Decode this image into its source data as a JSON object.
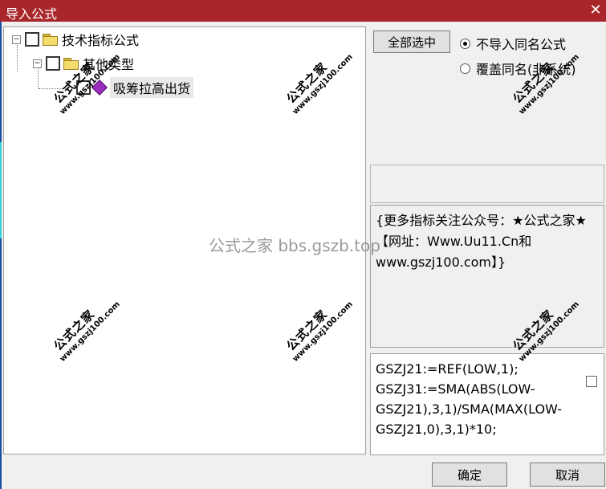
{
  "window": {
    "title": "导入公式",
    "close_glyph": "✕"
  },
  "tree": {
    "items": [
      {
        "label": "技术指标公式",
        "expander": "−",
        "icon": "folder-icon"
      },
      {
        "label": "其他类型",
        "expander": "−",
        "icon": "folder-icon"
      },
      {
        "label": "吸筹拉高出货",
        "icon": "formula-gem-icon"
      }
    ]
  },
  "options": {
    "select_all_label": "全部选中",
    "radio_skip_label": "不导入同名公式",
    "radio_overwrite_label": "覆盖同名(非系统)",
    "selected_radio": "skip"
  },
  "description": "{更多指标关注公众号：★公式之家★【网址：Www.Uu11.Cn和www.gszj100.com】}",
  "formula": "GSZJ21:=REF(LOW,1);\nGSZJ31:=SMA(ABS(LOW-GSZJ21),3,1)/SMA(MAX(LOW-GSZJ21,0),3,1)*10;",
  "buttons": {
    "ok": "确定",
    "cancel": "取消"
  },
  "watermarks": {
    "brand": "公式之家",
    "url": "www.gszj100.com",
    "overlay": "公式之家 bbs.gszb.top"
  },
  "colors": {
    "titlebar": "#a9262a"
  }
}
